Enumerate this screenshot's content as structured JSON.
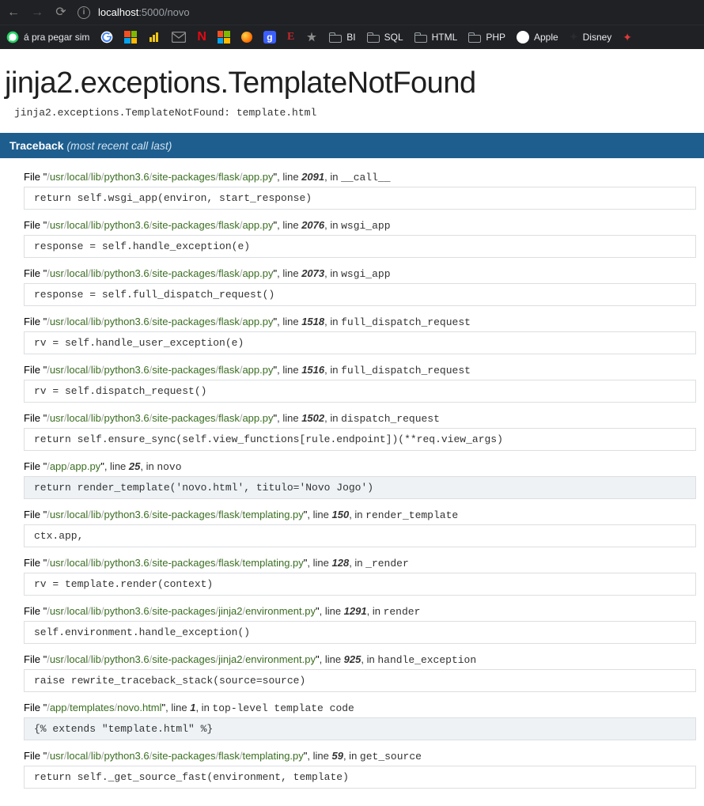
{
  "browser": {
    "nav": {
      "back_glyph": "←",
      "forward_glyph": "→",
      "reload_glyph": "⟳"
    },
    "info_glyph": "i",
    "url_host": "localhost",
    "url_rest": ":5000/novo",
    "bookmarks": [
      {
        "kind": "whatsapp",
        "label": "á pra pegar sim"
      },
      {
        "kind": "google"
      },
      {
        "kind": "ms-tiles"
      },
      {
        "kind": "powerbi"
      },
      {
        "kind": "mail"
      },
      {
        "kind": "netflix",
        "glyph": "N"
      },
      {
        "kind": "tiles-color"
      },
      {
        "kind": "circle-orange"
      },
      {
        "kind": "g-blue",
        "glyph": "g"
      },
      {
        "kind": "e-glyph",
        "glyph": "E"
      },
      {
        "kind": "star"
      },
      {
        "kind": "folder",
        "label": "BI"
      },
      {
        "kind": "folder",
        "label": "SQL"
      },
      {
        "kind": "folder",
        "label": "HTML"
      },
      {
        "kind": "folder",
        "label": "PHP"
      },
      {
        "kind": "apple",
        "label": "Apple",
        "glyph": ""
      },
      {
        "kind": "disney",
        "label": "Disney"
      },
      {
        "kind": "red-bird"
      }
    ]
  },
  "error": {
    "title": "jinja2.exceptions.TemplateNotFound",
    "exception_line": "jinja2.exceptions.TemplateNotFound: template.html",
    "tb_header": "Traceback",
    "tb_header_sub": "(most recent call last)",
    "strings": {
      "file_word": "File ",
      "quote": "\"",
      "line_part": ", line ",
      "in_part": ", in "
    },
    "frames": [
      {
        "path": "/usr/local/lib/python3.6/site-packages/flask/app.py",
        "line": "2091",
        "func": "__call__",
        "code": "return self.wsgi_app(environ, start_response)"
      },
      {
        "path": "/usr/local/lib/python3.6/site-packages/flask/app.py",
        "line": "2076",
        "func": "wsgi_app",
        "code": "response = self.handle_exception(e)"
      },
      {
        "path": "/usr/local/lib/python3.6/site-packages/flask/app.py",
        "line": "2073",
        "func": "wsgi_app",
        "code": "response = self.full_dispatch_request()"
      },
      {
        "path": "/usr/local/lib/python3.6/site-packages/flask/app.py",
        "line": "1518",
        "func": "full_dispatch_request",
        "code": "rv = self.handle_user_exception(e)"
      },
      {
        "path": "/usr/local/lib/python3.6/site-packages/flask/app.py",
        "line": "1516",
        "func": "full_dispatch_request",
        "code": "rv = self.dispatch_request()"
      },
      {
        "path": "/usr/local/lib/python3.6/site-packages/flask/app.py",
        "line": "1502",
        "func": "dispatch_request",
        "code": "return self.ensure_sync(self.view_functions[rule.endpoint])(**req.view_args)"
      },
      {
        "path": "/app/app.py",
        "line": "25",
        "func": "novo",
        "code": "return render_template('novo.html', titulo='Novo Jogo')",
        "highlight": true
      },
      {
        "path": "/usr/local/lib/python3.6/site-packages/flask/templating.py",
        "line": "150",
        "func": "render_template",
        "code": "ctx.app,"
      },
      {
        "path": "/usr/local/lib/python3.6/site-packages/flask/templating.py",
        "line": "128",
        "func": "_render",
        "code": "rv = template.render(context)"
      },
      {
        "path": "/usr/local/lib/python3.6/site-packages/jinja2/environment.py",
        "line": "1291",
        "func": "render",
        "code": "self.environment.handle_exception()"
      },
      {
        "path": "/usr/local/lib/python3.6/site-packages/jinja2/environment.py",
        "line": "925",
        "func": "handle_exception",
        "code": "raise rewrite_traceback_stack(source=source)"
      },
      {
        "path": "/app/templates/novo.html",
        "line": "1",
        "func": "top-level template code",
        "code": "{% extends \"template.html\" %}",
        "highlight": true
      },
      {
        "path": "/usr/local/lib/python3.6/site-packages/flask/templating.py",
        "line": "59",
        "func": "get_source",
        "code": "return self._get_source_fast(environment, template)"
      }
    ]
  }
}
